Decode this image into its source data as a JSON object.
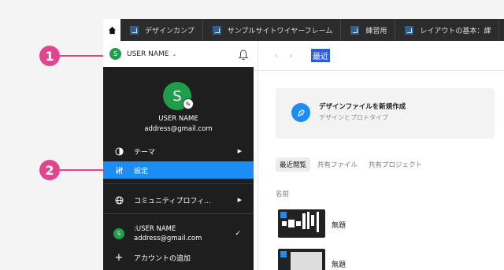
{
  "callouts": [
    "1",
    "2"
  ],
  "tabs": [
    {
      "label": "デザインカンプ"
    },
    {
      "label": "サンプルサイトワイヤーフレーム"
    },
    {
      "label": "練習用"
    },
    {
      "label": "レイアウトの基本：課"
    }
  ],
  "user": {
    "initial": "S",
    "name": "USER NAME",
    "email": "address@gmail.com"
  },
  "breadcrumb": "最近",
  "menu": {
    "theme": "テーマ",
    "settings": "設定",
    "community": "コミュニティプロフィ...",
    "account_name": ":USER NAME",
    "account_email": "address@gmail.com",
    "add_account": "アカウントの追加"
  },
  "new_file": {
    "title": "デザインファイルを新規作成",
    "subtitle": "デザインとプロトタイプ"
  },
  "filters": [
    "最近閲覧",
    "共有ファイル",
    "共有プロジェクト"
  ],
  "column_header": "名前",
  "files": [
    {
      "name": "無題"
    },
    {
      "name": "無題"
    }
  ],
  "colors": {
    "accent": "#1b8ef5",
    "callout": "#e0458e",
    "avatar": "#1f9d4a",
    "menu_bg": "#1e1e1e",
    "tabbar_bg": "#2c2c2c"
  }
}
